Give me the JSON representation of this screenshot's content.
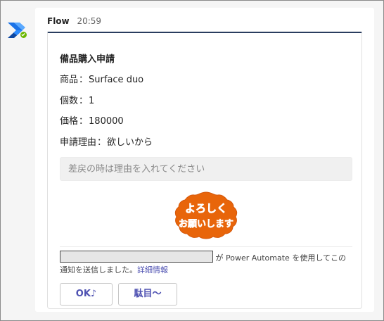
{
  "message": {
    "sender": "Flow",
    "time": "20:59"
  },
  "card": {
    "title": "備品購入申請",
    "facts": [
      {
        "label": "商品",
        "sep": "：",
        "value": "Surface duo"
      },
      {
        "label": "個数",
        "sep": "：",
        "value": "1"
      },
      {
        "label": "価格",
        "sep": "：",
        "value": "180000"
      },
      {
        "label": "申請理由",
        "sep": "：",
        "value": "欲しいから"
      }
    ],
    "reason_input": {
      "placeholder": "差戻の時は理由を入れてください",
      "value": ""
    },
    "sticker_text": {
      "line1": "よろしく",
      "line2": "お願いします"
    },
    "notice": {
      "text_a": "が Power Automate を使用してこの",
      "text_b": "通知を送信しました。",
      "link": "詳細情報"
    },
    "actions": {
      "ok_label": "OK♪",
      "ng_label": "駄目～"
    }
  },
  "colors": {
    "accent": "#4f52b2",
    "card_top_border": "#2a3d5f",
    "presence": "#6bb700",
    "sticker": "#e8650a",
    "logo_dark": "#0f5fc7",
    "logo_light": "#2d8cff"
  },
  "icons": {
    "avatar": "power-automate-logo",
    "presence": "available-check-icon"
  }
}
